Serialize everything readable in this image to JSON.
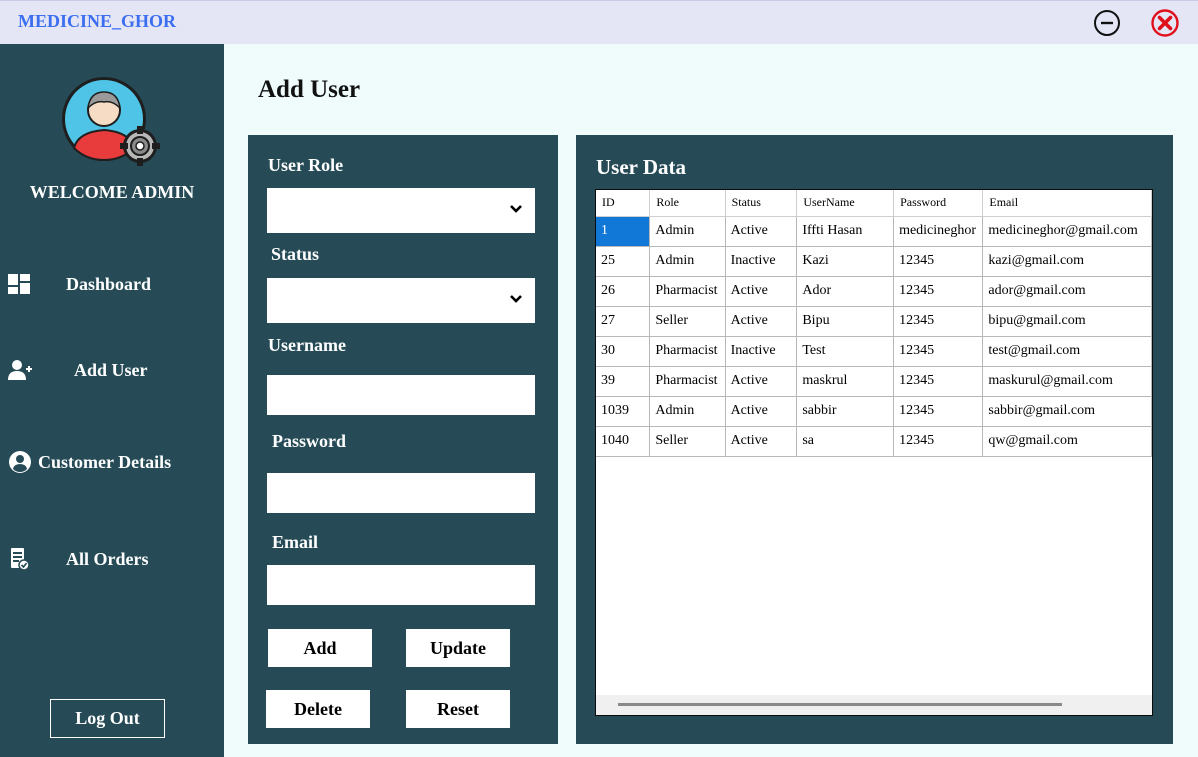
{
  "app": {
    "title": "MEDICINE_GHOR"
  },
  "sidebar": {
    "welcome": "WELCOME ADMIN",
    "items": [
      {
        "label": "Dashboard",
        "icon": "dashboard-icon"
      },
      {
        "label": "Add User",
        "icon": "add-user-icon"
      },
      {
        "label": "Customer Details",
        "icon": "customer-icon"
      },
      {
        "label": "All Orders",
        "icon": "orders-icon"
      }
    ],
    "logout_label": "Log Out"
  },
  "page": {
    "title": "Add User"
  },
  "form": {
    "role_label": "User Role",
    "role_value": "",
    "status_label": "Status",
    "status_value": "",
    "username_label": "Username",
    "username_value": "",
    "password_label": "Password",
    "password_value": "",
    "email_label": "Email",
    "email_value": "",
    "add_label": "Add",
    "update_label": "Update",
    "delete_label": "Delete",
    "reset_label": "Reset"
  },
  "user_data": {
    "title": "User Data",
    "columns": [
      "ID",
      "Role",
      "Status",
      "UserName",
      "Password",
      "Email"
    ],
    "rows": [
      [
        "1",
        "Admin",
        "Active",
        "Iffti Hasan",
        "medicineghor",
        "medicineghor@gmail.com"
      ],
      [
        "25",
        "Admin",
        "Inactive",
        "Kazi",
        "12345",
        "kazi@gmail.com"
      ],
      [
        "26",
        "Pharmacist",
        "Active",
        "Ador",
        "12345",
        "ador@gmail.com"
      ],
      [
        "27",
        "Seller",
        "Active",
        "Bipu",
        "12345",
        "bipu@gmail.com"
      ],
      [
        "30",
        "Pharmacist",
        "Inactive",
        "Test",
        "12345",
        "test@gmail.com"
      ],
      [
        "39",
        "Pharmacist",
        "Active",
        "maskrul",
        "12345",
        "maskurul@gmail.com"
      ],
      [
        "1039",
        "Admin",
        "Active",
        "sabbir",
        "12345",
        "sabbir@gmail.com"
      ],
      [
        "1040",
        "Seller",
        "Active",
        "sa",
        "12345",
        "qw@gmail.com"
      ]
    ]
  },
  "colors": {
    "panel": "#264b56",
    "title_accent": "#3c6ef0",
    "selected_cell": "#1178d8",
    "close_red": "#e0101a"
  }
}
